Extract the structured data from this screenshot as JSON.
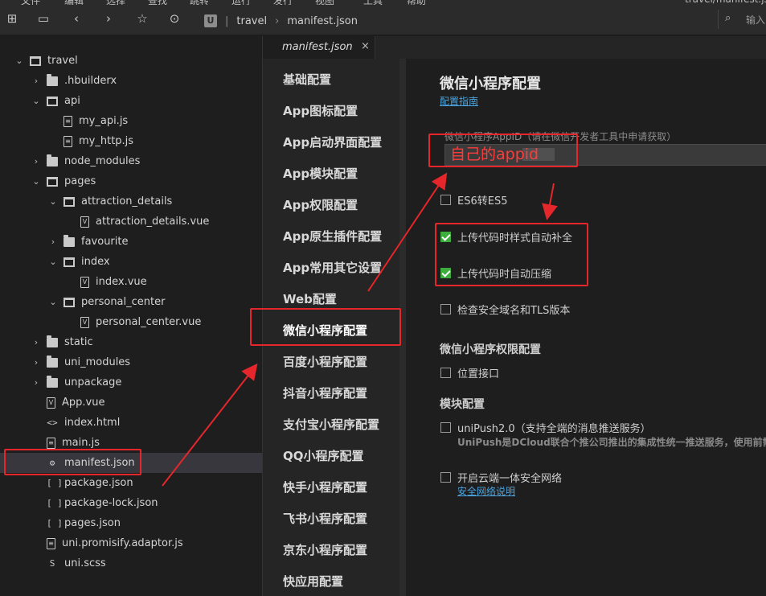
{
  "toolbar": {
    "menu_fragments": [
      "文件",
      "编辑",
      "选择",
      "查找",
      "跳转",
      "运行",
      "发行",
      "视图",
      "工具",
      "帮助"
    ],
    "window_title_fragment": "travel/manifest.json",
    "breadcrumb": [
      "travel",
      "manifest.json"
    ],
    "search_placeholder": "输入"
  },
  "tree": [
    {
      "label": "travel",
      "type": "folder-open",
      "depth": 0,
      "expanded": true
    },
    {
      "label": ".hbuilderx",
      "type": "folder",
      "depth": 1,
      "expanded": false
    },
    {
      "label": "api",
      "type": "folder-open",
      "depth": 1,
      "expanded": true
    },
    {
      "label": "my_api.js",
      "type": "js",
      "depth": 2
    },
    {
      "label": "my_http.js",
      "type": "js",
      "depth": 2
    },
    {
      "label": "node_modules",
      "type": "folder",
      "depth": 1,
      "expanded": false
    },
    {
      "label": "pages",
      "type": "folder-open",
      "depth": 1,
      "expanded": true
    },
    {
      "label": "attraction_details",
      "type": "folder-open",
      "depth": 2,
      "expanded": true
    },
    {
      "label": "attraction_details.vue",
      "type": "vue",
      "depth": 3
    },
    {
      "label": "favourite",
      "type": "folder",
      "depth": 2,
      "expanded": false
    },
    {
      "label": "index",
      "type": "folder-open",
      "depth": 2,
      "expanded": true
    },
    {
      "label": "index.vue",
      "type": "vue",
      "depth": 3
    },
    {
      "label": "personal_center",
      "type": "folder-open",
      "depth": 2,
      "expanded": true
    },
    {
      "label": "personal_center.vue",
      "type": "vue",
      "depth": 3
    },
    {
      "label": "static",
      "type": "folder",
      "depth": 1,
      "expanded": false
    },
    {
      "label": "uni_modules",
      "type": "folder",
      "depth": 1,
      "expanded": false
    },
    {
      "label": "unpackage",
      "type": "folder",
      "depth": 1,
      "expanded": false
    },
    {
      "label": "App.vue",
      "type": "vue",
      "depth": 1
    },
    {
      "label": "index.html",
      "type": "html",
      "depth": 1
    },
    {
      "label": "main.js",
      "type": "js",
      "depth": 1
    },
    {
      "label": "manifest.json",
      "type": "manifest",
      "depth": 1,
      "selected": true
    },
    {
      "label": "package.json",
      "type": "json",
      "depth": 1
    },
    {
      "label": "package-lock.json",
      "type": "json",
      "depth": 1
    },
    {
      "label": "pages.json",
      "type": "json",
      "depth": 1
    },
    {
      "label": "uni.promisify.adaptor.js",
      "type": "js",
      "depth": 1
    },
    {
      "label": "uni.scss",
      "type": "scss",
      "depth": 1
    }
  ],
  "tab": {
    "label": "manifest.json",
    "close": "×"
  },
  "nav": [
    "基础配置",
    "App图标配置",
    "App启动界面配置",
    "App模块配置",
    "App权限配置",
    "App原生插件配置",
    "App常用其它设置",
    "Web配置",
    "微信小程序配置",
    "百度小程序配置",
    "抖音小程序配置",
    "支付宝小程序配置",
    "QQ小程序配置",
    "快手小程序配置",
    "飞书小程序配置",
    "京东小程序配置",
    "快应用配置"
  ],
  "nav_active_index": 8,
  "content": {
    "title": "微信小程序配置",
    "guide_link": "配置指南",
    "appid_label": "微信小程序AppID（请在微信开发者工具中申请获取）",
    "appid_value": "",
    "options": [
      {
        "label": "ES6转ES5",
        "checked": false
      },
      {
        "label": "上传代码时样式自动补全",
        "checked": true
      },
      {
        "label": "上传代码时自动压缩",
        "checked": true
      },
      {
        "label": "检查安全域名和TLS版本",
        "checked": false
      }
    ],
    "perm_section": "微信小程序权限配置",
    "perm_option": {
      "label": "位置接口",
      "checked": false
    },
    "module_section": "模块配置",
    "unipush": {
      "label": "uniPush2.0（支持全端的消息推送服务）",
      "checked": false,
      "desc": "UniPush是DCloud联合个推公司推出的集成性统一推送服务，使用前需"
    },
    "secure": {
      "label": "开启云端一体安全网络",
      "checked": false,
      "link": "安全网络说明"
    }
  },
  "annotation": {
    "text": "自己的appid",
    "color": "#e5262b"
  }
}
